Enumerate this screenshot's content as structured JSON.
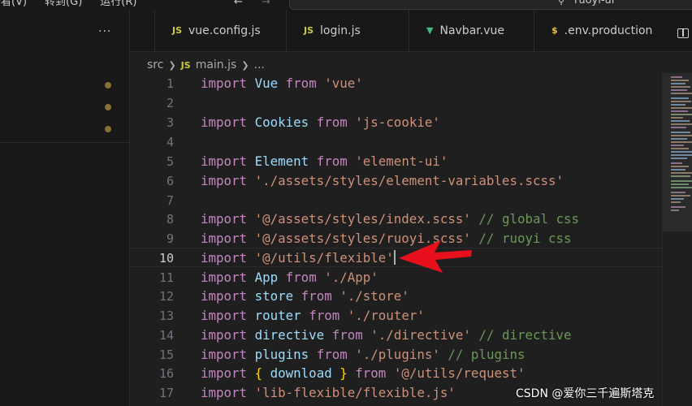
{
  "menubar": {
    "items": [
      "查看(V)",
      "转到(G)",
      "运行(R)"
    ]
  },
  "search": {
    "text": "ruoyi-ui"
  },
  "tabs": [
    {
      "label": "vue.config.js",
      "icon_text": "JS",
      "icon": "javascript-icon"
    },
    {
      "label": "login.js",
      "icon_text": "JS",
      "icon": "javascript-icon"
    },
    {
      "label": "Navbar.vue",
      "icon_text": "▼",
      "icon": "vue-icon"
    },
    {
      "label": ".env.production",
      "icon_text": "$",
      "icon": "env-icon"
    }
  ],
  "breadcrumb": {
    "folder": "src",
    "file_icon": "JS",
    "file": "main.js",
    "more": "..."
  },
  "editor": {
    "active_line": 10,
    "line_numbers": [
      "1",
      "2",
      "3",
      "4",
      "5",
      "6",
      "7",
      "8",
      "9",
      "10",
      "11",
      "12",
      "13",
      "14",
      "15",
      "16",
      "17"
    ],
    "lines": [
      {
        "import": "import",
        "name": "Vue",
        "from": "from",
        "src": "'vue'"
      },
      {},
      {
        "import": "import",
        "name": "Cookies",
        "from": "from",
        "src": "'js-cookie'"
      },
      {},
      {
        "import": "import",
        "name": "Element",
        "from": "from",
        "src": "'element-ui'"
      },
      {
        "import": "import",
        "src": "'./assets/styles/element-variables.scss'"
      },
      {},
      {
        "import": "import",
        "src": "'@/assets/styles/index.scss'",
        "comment": "// global css"
      },
      {
        "import": "import",
        "src": "'@/assets/styles/ruoyi.scss'",
        "comment": "// ruoyi css"
      },
      {
        "import": "import",
        "src": "'@/utils/flexible'"
      },
      {
        "import": "import",
        "name": "App",
        "from": "from",
        "src": "'./App'"
      },
      {
        "import": "import",
        "name": "store",
        "from": "from",
        "src": "'./store'"
      },
      {
        "import": "import",
        "name": "router",
        "from": "from",
        "src": "'./router'"
      },
      {
        "import": "import",
        "name": "directive",
        "from": "from",
        "src": "'./directive'",
        "comment": "// directive"
      },
      {
        "import": "import",
        "name": "plugins",
        "from": "from",
        "src": "'./plugins'",
        "comment": "// plugins"
      },
      {
        "import": "import",
        "brace_open": "{",
        "name": "download",
        "brace_close": "}",
        "from": "from",
        "src": "'@/utils/request'"
      },
      {
        "import": "import",
        "src": "'lib-flexible/flexible.js'"
      }
    ]
  },
  "watermark": "CSDN @爱你三千遍斯塔克",
  "colors": {
    "keyword": "#c586c0",
    "identifier": "#9cdcfe",
    "string": "#ce9178",
    "comment": "#6a9955",
    "arrow": "#e8101c",
    "modified_dot": "#867231"
  }
}
